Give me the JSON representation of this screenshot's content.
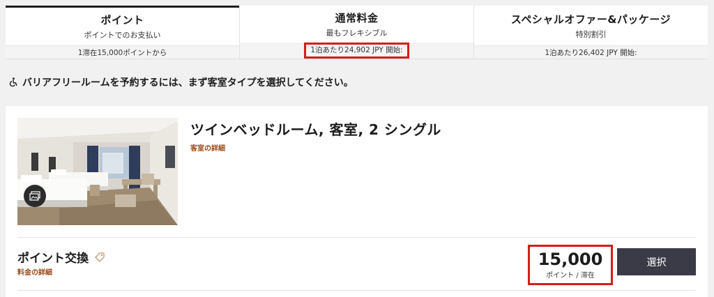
{
  "tabs": [
    {
      "title": "ポイント",
      "subtitle": "ポイントでのお支払い",
      "price": "1滞在15,000ポイントから",
      "active": true
    },
    {
      "title": "通常料金",
      "subtitle": "最もフレキシブル",
      "price": "1泊あたり24,902 JPY 開始:",
      "active": false
    },
    {
      "title": "スペシャルオファー&パッケージ",
      "subtitle": "特別割引",
      "price": "1泊あたり26,402 JPY 開始:",
      "active": false
    }
  ],
  "notice": {
    "icon": "wheelchair-icon",
    "text": "バリアフリールームを予約するには、まず客室タイプを選択してください。"
  },
  "room": {
    "title": "ツインベッドルーム, 客室, 2 シングル",
    "details_link": "客室の詳細",
    "photo_icon": "gallery-icon"
  },
  "rate": {
    "name": "ポイント交換",
    "tag_icon": "tag-icon",
    "details_link": "料金の詳細",
    "points": "15,000",
    "points_unit": "ポイント / 滞在",
    "select_label": "選択"
  },
  "colors": {
    "highlight": "#d71c1c",
    "link": "#9a4a18",
    "button": "#3b3a47"
  }
}
